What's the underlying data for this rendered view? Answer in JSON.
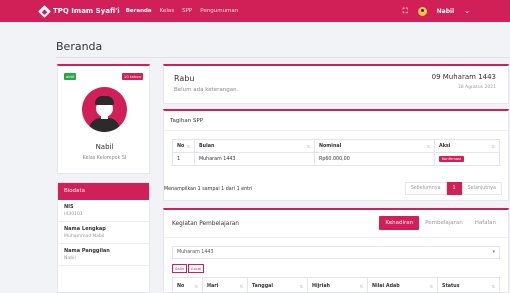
{
  "navbar": {
    "brand": "TPQ Imam Syafi'i",
    "links": [
      "Beranda",
      "Kelas",
      "SPP",
      "Pengumuman"
    ],
    "user": "Nabil",
    "icons": [
      "diamond-logo-icon",
      "expand-icon",
      "avatar",
      "chevron-down-icon"
    ]
  },
  "page": {
    "title": "Beranda"
  },
  "profile": {
    "status_badge": "aktif",
    "age_badge": "10 tahun",
    "name": "Nabil",
    "class": "Kelas Kelompok SI"
  },
  "biodata": {
    "title": "Biodata",
    "fields": [
      {
        "label": "NIS",
        "value": "I430101"
      },
      {
        "label": "Nama Lengkap",
        "value": "Muhammad Nabil"
      },
      {
        "label": "Nama Panggilan",
        "value": "Nabil"
      }
    ]
  },
  "date_card": {
    "day": "Rabu",
    "description": "Belum ada keterangan.",
    "hijri_date": "09 Muharam 1443",
    "gregorian_date": "18 Agustus 2021"
  },
  "spp": {
    "title": "Tagihan SPP",
    "columns": [
      "No",
      "Bulan",
      "Nominal",
      "Aksi"
    ],
    "rows": [
      {
        "no": "1",
        "bulan": "Muharam 1443",
        "nominal": "Rp60.000,00",
        "aksi": "Konfirmasi"
      }
    ],
    "info": "Menampilkan 1 sampai 1 dari 1 entri",
    "pager": {
      "prev": "Sebelumnya",
      "page": "1",
      "next": "Selanjutnya"
    }
  },
  "kegiatan": {
    "title": "Kegiatan Pembelajaran",
    "tabs": [
      "Kehadiran",
      "Pembelajaran",
      "Hafalan"
    ],
    "active_tab": "Kehadiran",
    "select_value": "Muharam 1443",
    "export_buttons": [
      "Salin",
      "Excel"
    ],
    "columns": [
      "No",
      "Hari",
      "Tanggal",
      "Hijriah",
      "Nilai Adab",
      "Status"
    ]
  },
  "colors": {
    "accent": "#d11f57",
    "background": "#f2f3f7",
    "success": "#28a745"
  }
}
